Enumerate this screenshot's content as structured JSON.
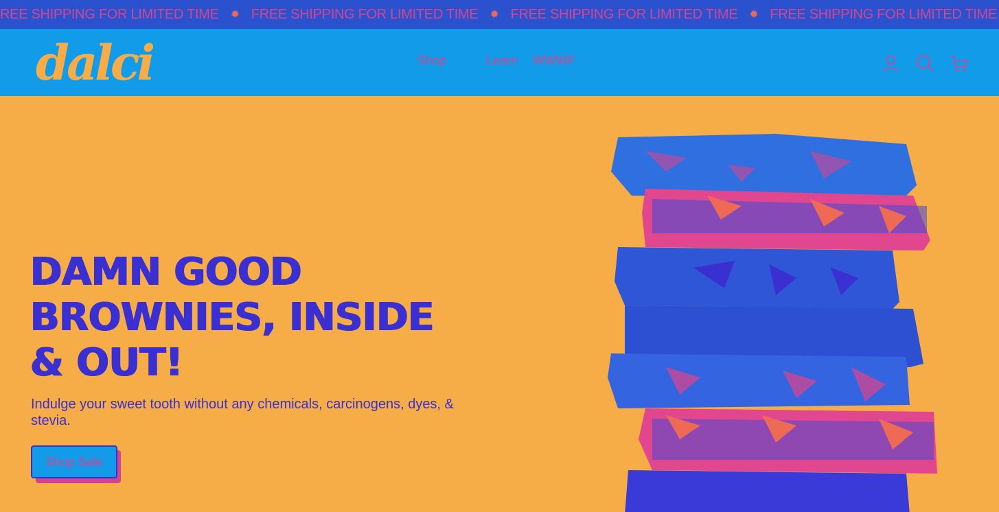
{
  "announcement": {
    "items": [
      "FREE SHIPPING FOR LIMITED TIME",
      "FREE SHIPPING FOR LIMITED TIME",
      "FREE SHIPPING FOR LIMITED TIME",
      "FREE SHIPPING FOR LIMITED TIME"
    ],
    "separator_icon": "sun-icon"
  },
  "header": {
    "logo": "dalci",
    "nav": {
      "shop": "Shop",
      "learn": "Learn",
      "wwwf": "WWWF"
    },
    "icons": [
      "account-icon",
      "search-icon",
      "cart-icon"
    ]
  },
  "hero": {
    "headline": "DAMN GOOD BROWNIES, INSIDE & OUT!",
    "subtext": "Indulge your sweet tooth without any chemicals, carcinogens, dyes, & stevia.",
    "cta_label": "Shop Sale",
    "image": "brownie-stack"
  },
  "colors": {
    "background": "#f6ad48",
    "header": "#129be8",
    "marquee": "#2a52cf",
    "accent_text": "#d6448f",
    "headline": "#3a2fd0"
  }
}
